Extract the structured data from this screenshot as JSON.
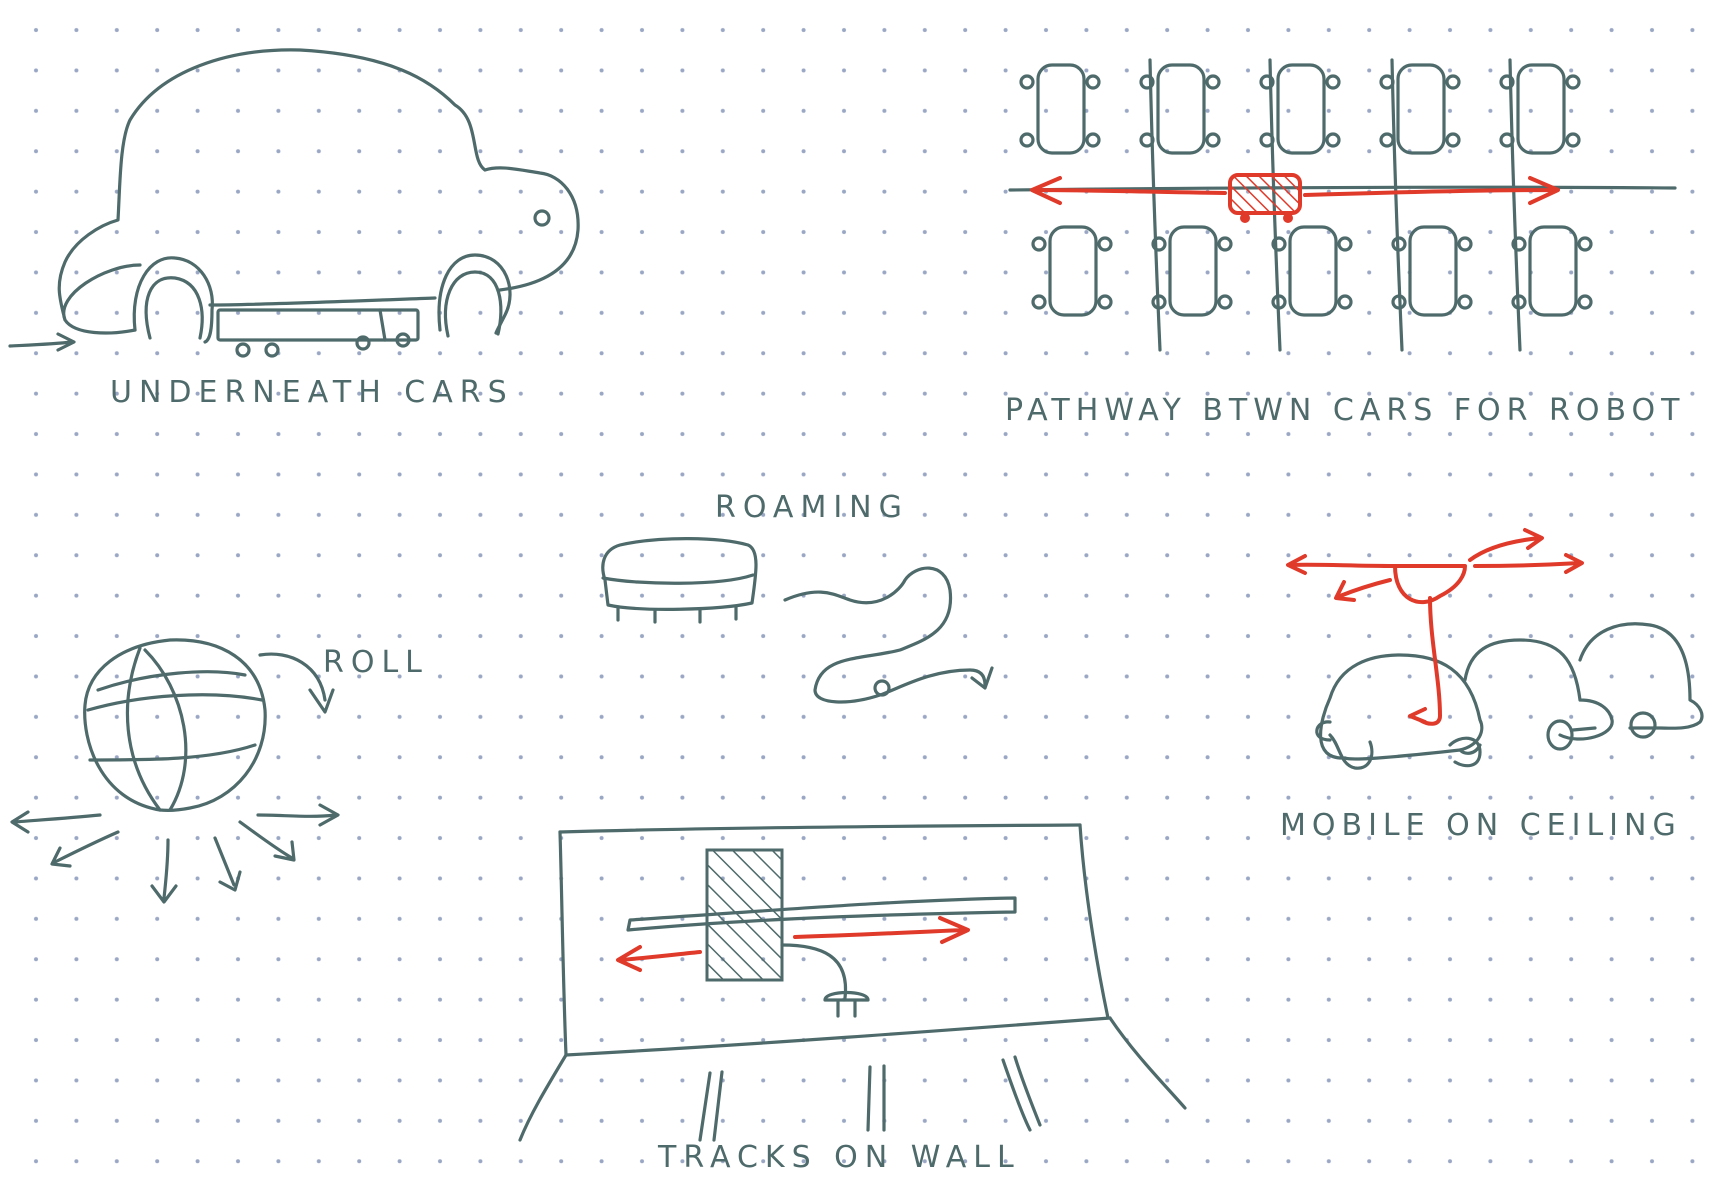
{
  "sketch": {
    "ink_color": "#4e6a6a",
    "accent_color": "#e03a2b",
    "dot_color": "#9aa7c4",
    "labels": {
      "underneath": "UNDERNEATH CARS",
      "pathway": "PATHWAY BTWN CARS FOR ROBOT",
      "roaming": "ROAMING",
      "roll": "ROLL",
      "ceiling": "MOBILE ON CEILING",
      "tracks": "TRACKS ON WALL"
    }
  }
}
